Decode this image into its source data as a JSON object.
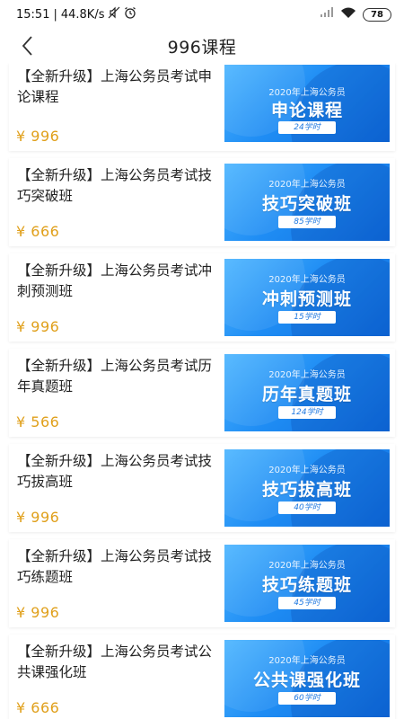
{
  "status_bar": {
    "time": "15:51",
    "net_speed": "44.8K/s",
    "battery": "78",
    "icons": [
      "mute-icon",
      "alarm-icon",
      "signal-icon",
      "wifi-icon",
      "battery-icon"
    ]
  },
  "header": {
    "title": "996课程",
    "back_icon": "chevron-left-icon"
  },
  "colors": {
    "price": "#e0a01c",
    "thumb_blue": "#1f8df4"
  },
  "courses": [
    {
      "title": "【全新升级】上海公务员考试申论课程",
      "price": "¥ 996",
      "thumb_sub": "2020年上海公务员",
      "thumb_main": "申论课程",
      "thumb_hours": "24学时"
    },
    {
      "title": "【全新升级】上海公务员考试技巧突破班",
      "price": "¥ 666",
      "thumb_sub": "2020年上海公务员",
      "thumb_main": "技巧突破班",
      "thumb_hours": "85学时"
    },
    {
      "title": "【全新升级】上海公务员考试冲刺预测班",
      "price": "¥ 996",
      "thumb_sub": "2020年上海公务员",
      "thumb_main": "冲刺预测班",
      "thumb_hours": "15学时"
    },
    {
      "title": "【全新升级】上海公务员考试历年真题班",
      "price": "¥ 566",
      "thumb_sub": "2020年上海公务员",
      "thumb_main": "历年真题班",
      "thumb_hours": "124学时"
    },
    {
      "title": "【全新升级】上海公务员考试技巧拔高班",
      "price": "¥ 996",
      "thumb_sub": "2020年上海公务员",
      "thumb_main": "技巧拔高班",
      "thumb_hours": "40学时"
    },
    {
      "title": "【全新升级】上海公务员考试技巧练题班",
      "price": "¥ 996",
      "thumb_sub": "2020年上海公务员",
      "thumb_main": "技巧练题班",
      "thumb_hours": "45学时"
    },
    {
      "title": "【全新升级】上海公务员考试公共课强化班",
      "price": "¥ 666",
      "thumb_sub": "2020年上海公务员",
      "thumb_main": "公共课强化班",
      "thumb_hours": "60学时"
    }
  ]
}
